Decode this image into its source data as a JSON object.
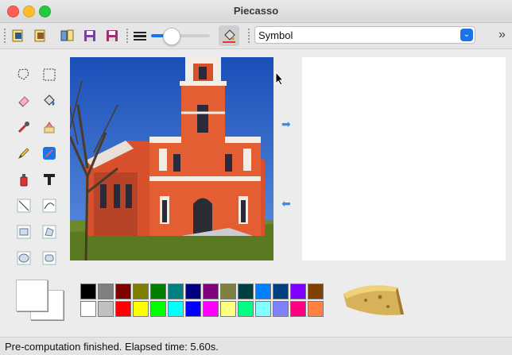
{
  "window": {
    "title": "Piecasso"
  },
  "toolbar": {
    "buttons": [
      "open-icon",
      "open2-icon",
      "open3-icon",
      "save-icon",
      "save-as-icon",
      "line-width-icon",
      "fill-icon"
    ],
    "brush_size_fraction": 0.3,
    "symbol_combo": {
      "value": "Symbol"
    },
    "overflow_label": "»"
  },
  "tools": [
    "freeform-select-icon",
    "rect-select-icon",
    "eraser-icon",
    "fill-bucket-icon",
    "color-picker-icon",
    "stamp-icon",
    "pencil-icon",
    "brush-icon",
    "spray-icon",
    "text-icon",
    "line-icon",
    "curve-icon",
    "rectangle-icon",
    "polygon-icon",
    "ellipse-icon",
    "rounded-rect-icon"
  ],
  "arrows": {
    "right": "➡",
    "left": "⬅"
  },
  "palette": {
    "row1": [
      "#000000",
      "#808080",
      "#800000",
      "#808000",
      "#008000",
      "#008080",
      "#000080",
      "#800080",
      "#808040",
      "#004040",
      "#0080ff",
      "#004080",
      "#8000ff",
      "#804000"
    ],
    "row2": [
      "#ffffff",
      "#c0c0c0",
      "#ff0000",
      "#ffff00",
      "#00ff00",
      "#00ffff",
      "#0000ff",
      "#ff00ff",
      "#ffff80",
      "#00ff80",
      "#80ffff",
      "#8080ff",
      "#ff0080",
      "#ff8040"
    ]
  },
  "status": {
    "text": "Pre-computation finished. Elapsed time: 5.60s."
  }
}
